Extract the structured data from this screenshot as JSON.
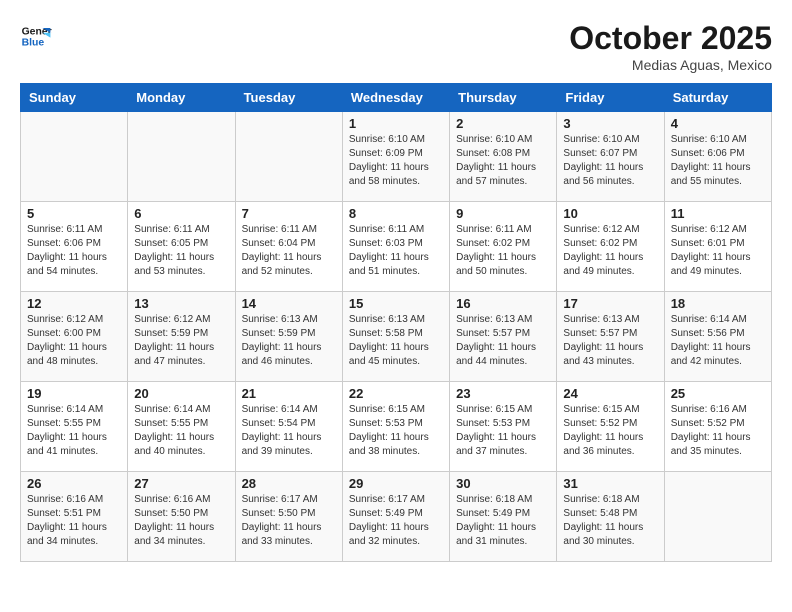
{
  "header": {
    "logo_line1": "General",
    "logo_line2": "Blue",
    "month": "October 2025",
    "location": "Medias Aguas, Mexico"
  },
  "weekdays": [
    "Sunday",
    "Monday",
    "Tuesday",
    "Wednesday",
    "Thursday",
    "Friday",
    "Saturday"
  ],
  "weeks": [
    [
      {
        "day": "",
        "info": ""
      },
      {
        "day": "",
        "info": ""
      },
      {
        "day": "",
        "info": ""
      },
      {
        "day": "1",
        "info": "Sunrise: 6:10 AM\nSunset: 6:09 PM\nDaylight: 11 hours\nand 58 minutes."
      },
      {
        "day": "2",
        "info": "Sunrise: 6:10 AM\nSunset: 6:08 PM\nDaylight: 11 hours\nand 57 minutes."
      },
      {
        "day": "3",
        "info": "Sunrise: 6:10 AM\nSunset: 6:07 PM\nDaylight: 11 hours\nand 56 minutes."
      },
      {
        "day": "4",
        "info": "Sunrise: 6:10 AM\nSunset: 6:06 PM\nDaylight: 11 hours\nand 55 minutes."
      }
    ],
    [
      {
        "day": "5",
        "info": "Sunrise: 6:11 AM\nSunset: 6:06 PM\nDaylight: 11 hours\nand 54 minutes."
      },
      {
        "day": "6",
        "info": "Sunrise: 6:11 AM\nSunset: 6:05 PM\nDaylight: 11 hours\nand 53 minutes."
      },
      {
        "day": "7",
        "info": "Sunrise: 6:11 AM\nSunset: 6:04 PM\nDaylight: 11 hours\nand 52 minutes."
      },
      {
        "day": "8",
        "info": "Sunrise: 6:11 AM\nSunset: 6:03 PM\nDaylight: 11 hours\nand 51 minutes."
      },
      {
        "day": "9",
        "info": "Sunrise: 6:11 AM\nSunset: 6:02 PM\nDaylight: 11 hours\nand 50 minutes."
      },
      {
        "day": "10",
        "info": "Sunrise: 6:12 AM\nSunset: 6:02 PM\nDaylight: 11 hours\nand 49 minutes."
      },
      {
        "day": "11",
        "info": "Sunrise: 6:12 AM\nSunset: 6:01 PM\nDaylight: 11 hours\nand 49 minutes."
      }
    ],
    [
      {
        "day": "12",
        "info": "Sunrise: 6:12 AM\nSunset: 6:00 PM\nDaylight: 11 hours\nand 48 minutes."
      },
      {
        "day": "13",
        "info": "Sunrise: 6:12 AM\nSunset: 5:59 PM\nDaylight: 11 hours\nand 47 minutes."
      },
      {
        "day": "14",
        "info": "Sunrise: 6:13 AM\nSunset: 5:59 PM\nDaylight: 11 hours\nand 46 minutes."
      },
      {
        "day": "15",
        "info": "Sunrise: 6:13 AM\nSunset: 5:58 PM\nDaylight: 11 hours\nand 45 minutes."
      },
      {
        "day": "16",
        "info": "Sunrise: 6:13 AM\nSunset: 5:57 PM\nDaylight: 11 hours\nand 44 minutes."
      },
      {
        "day": "17",
        "info": "Sunrise: 6:13 AM\nSunset: 5:57 PM\nDaylight: 11 hours\nand 43 minutes."
      },
      {
        "day": "18",
        "info": "Sunrise: 6:14 AM\nSunset: 5:56 PM\nDaylight: 11 hours\nand 42 minutes."
      }
    ],
    [
      {
        "day": "19",
        "info": "Sunrise: 6:14 AM\nSunset: 5:55 PM\nDaylight: 11 hours\nand 41 minutes."
      },
      {
        "day": "20",
        "info": "Sunrise: 6:14 AM\nSunset: 5:55 PM\nDaylight: 11 hours\nand 40 minutes."
      },
      {
        "day": "21",
        "info": "Sunrise: 6:14 AM\nSunset: 5:54 PM\nDaylight: 11 hours\nand 39 minutes."
      },
      {
        "day": "22",
        "info": "Sunrise: 6:15 AM\nSunset: 5:53 PM\nDaylight: 11 hours\nand 38 minutes."
      },
      {
        "day": "23",
        "info": "Sunrise: 6:15 AM\nSunset: 5:53 PM\nDaylight: 11 hours\nand 37 minutes."
      },
      {
        "day": "24",
        "info": "Sunrise: 6:15 AM\nSunset: 5:52 PM\nDaylight: 11 hours\nand 36 minutes."
      },
      {
        "day": "25",
        "info": "Sunrise: 6:16 AM\nSunset: 5:52 PM\nDaylight: 11 hours\nand 35 minutes."
      }
    ],
    [
      {
        "day": "26",
        "info": "Sunrise: 6:16 AM\nSunset: 5:51 PM\nDaylight: 11 hours\nand 34 minutes."
      },
      {
        "day": "27",
        "info": "Sunrise: 6:16 AM\nSunset: 5:50 PM\nDaylight: 11 hours\nand 34 minutes."
      },
      {
        "day": "28",
        "info": "Sunrise: 6:17 AM\nSunset: 5:50 PM\nDaylight: 11 hours\nand 33 minutes."
      },
      {
        "day": "29",
        "info": "Sunrise: 6:17 AM\nSunset: 5:49 PM\nDaylight: 11 hours\nand 32 minutes."
      },
      {
        "day": "30",
        "info": "Sunrise: 6:18 AM\nSunset: 5:49 PM\nDaylight: 11 hours\nand 31 minutes."
      },
      {
        "day": "31",
        "info": "Sunrise: 6:18 AM\nSunset: 5:48 PM\nDaylight: 11 hours\nand 30 minutes."
      },
      {
        "day": "",
        "info": ""
      }
    ]
  ]
}
